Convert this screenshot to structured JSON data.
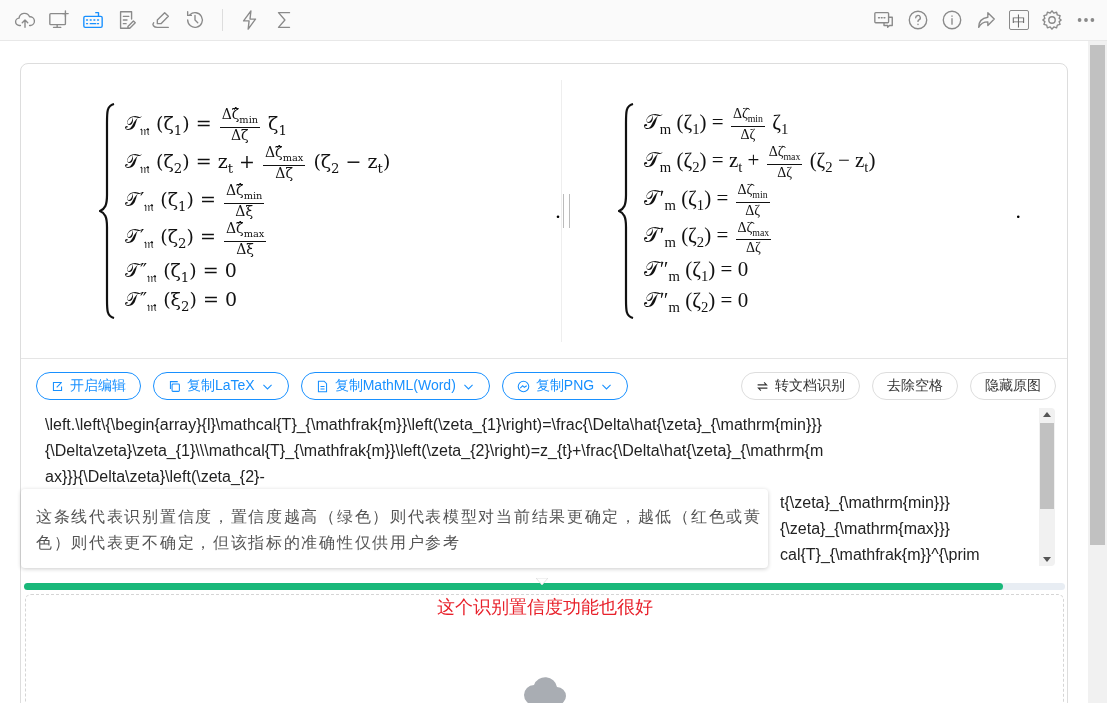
{
  "toolbar": {
    "left": [
      {
        "kind": "cloud-upload",
        "selected": false
      },
      {
        "kind": "monitor-plus",
        "selected": false
      },
      {
        "kind": "keyboard",
        "selected": true
      },
      {
        "kind": "document-edit",
        "selected": false
      },
      {
        "kind": "signature",
        "selected": false
      },
      {
        "kind": "history",
        "selected": false
      },
      {
        "kind": "divider"
      },
      {
        "kind": "lightning",
        "selected": false
      },
      {
        "kind": "sigma",
        "selected": false
      }
    ],
    "right": [
      {
        "kind": "chat",
        "selected": false
      },
      {
        "kind": "help",
        "selected": false
      },
      {
        "kind": "info",
        "selected": false
      },
      {
        "kind": "share",
        "selected": false
      },
      {
        "kind": "glyph",
        "text": "中",
        "selected": false
      },
      {
        "kind": "settings",
        "selected": false
      },
      {
        "kind": "more",
        "selected": false
      }
    ]
  },
  "formula_panels": [
    {
      "terminator": ".",
      "lines": [
        [
          {
            "kind": "text",
            "text": "𝒯$_{𝔪}$ (ζ$_{1}$) = "
          },
          {
            "kind": "frac",
            "num": "Δζ̂$_{min}$",
            "den": "Δζ"
          },
          {
            "kind": "text",
            "text": " ζ$_{1}$"
          }
        ],
        [
          {
            "kind": "text",
            "text": "𝒯$_{𝔪}$ (ζ$_{2}$) = z$_{t}$ + "
          },
          {
            "kind": "frac",
            "num": "Δζ̂$_{max}$",
            "den": "Δζ"
          },
          {
            "kind": "text",
            "text": " (ζ$_{2}$ − z$_{t}$)"
          }
        ],
        [
          {
            "kind": "text",
            "text": "𝒯′$_{𝔪}$ (ζ$_{1}$) = "
          },
          {
            "kind": "frac",
            "num": "Δζ̂$_{min}$",
            "den": "Δξ"
          }
        ],
        [
          {
            "kind": "text",
            "text": "𝒯′$_{𝔪}$ (ζ$_{2}$) = "
          },
          {
            "kind": "frac",
            "num": "Δζ̂$_{max}$",
            "den": "Δξ"
          }
        ],
        [
          {
            "kind": "text",
            "text": "𝒯″$_{𝔪}$ (ζ$_{1}$) = 0"
          }
        ],
        [
          {
            "kind": "text",
            "text": "𝒯″$_{𝔪}$ (ξ$_{2}$) = 0"
          }
        ]
      ]
    },
    {
      "terminator": ".",
      "lines": [
        [
          {
            "kind": "text",
            "text": "𝒯$_{m}$ (ζ$_{1}$) = "
          },
          {
            "kind": "frac",
            "num": "Δζ̂$_{min}$",
            "den": "Δζ"
          },
          {
            "kind": "text",
            "text": " ζ$_{1}$"
          }
        ],
        [
          {
            "kind": "text",
            "text": "𝒯$_{m}$ (ζ$_{2}$) = z$_{t}$ + "
          },
          {
            "kind": "frac",
            "num": "Δζ̂$_{max}$",
            "den": "Δζ"
          },
          {
            "kind": "text",
            "text": " (ζ$_{2}$ − z$_{t}$)"
          }
        ],
        [
          {
            "kind": "text",
            "text": "𝒯′$_{m}$ (ζ$_{1}$) = "
          },
          {
            "kind": "frac",
            "num": "Δζ̂$_{min}$",
            "den": "Δζ"
          }
        ],
        [
          {
            "kind": "text",
            "text": "𝒯′$_{m}$ (ζ$_{2}$) = "
          },
          {
            "kind": "frac",
            "num": "Δζ̂$_{max}$",
            "den": "Δζ"
          }
        ],
        [
          {
            "kind": "text",
            "text": "𝒯″$_{m}$ (ζ$_{1}$) = 0"
          }
        ],
        [
          {
            "kind": "text",
            "text": "𝒯″$_{m}$ (ζ$_{2}$) = 0"
          }
        ]
      ]
    }
  ],
  "actions": [
    {
      "kind": "primary",
      "label": "开启编辑",
      "dropdown": false
    },
    {
      "kind": "primary",
      "label": "复制LaTeX",
      "dropdown": true
    },
    {
      "kind": "primary",
      "label": "复制MathML(Word)",
      "dropdown": true
    },
    {
      "kind": "primary",
      "label": "复制PNG",
      "dropdown": true
    },
    {
      "kind": "default",
      "label": "转文档识别",
      "dropdown": false
    },
    {
      "kind": "default",
      "label": "去除空格",
      "dropdown": false
    },
    {
      "kind": "default",
      "label": "隐藏原图",
      "dropdown": false
    }
  ],
  "latex_editor": {
    "lines": [
      {
        "kind": "full",
        "text": "\\left.\\left\\{\\begin{array}{l}\\mathcal{T}_{\\mathfrak{m}}\\left(\\zeta_{1}\\right)=\\frac{\\Delta\\hat{\\zeta}_{\\mathrm{min}}}"
      },
      {
        "kind": "full",
        "text": "{\\Delta\\zeta}\\zeta_{1}\\\\\\mathcal{T}_{\\mathfrak{m}}\\left(\\zeta_{2}\\right)=z_{t}+\\frac{\\Delta\\hat{\\zeta}_{\\mathrm{m"
      },
      {
        "kind": "full",
        "text": "ax}}}{\\Delta\\zeta}\\left(\\zeta_{2}-"
      },
      {
        "kind": "tail",
        "text": "t{\\zeta}_{\\mathrm{min}}}"
      },
      {
        "kind": "tail",
        "text": "{\\zeta}_{\\mathrm{max}}}"
      },
      {
        "kind": "tail",
        "text": "cal{T}_{\\mathfrak{m}}^{\\prim"
      }
    ]
  },
  "tooltip": "这条线代表识别置信度，置信度越高（绿色）则代表模型对当前结果更确定，越低（红色或黄色）则代表更不确定，但该指标的准确性仅供用户参考",
  "confidence": {
    "level": 0.94
  },
  "annotation": "这个识别置信度功能也很好"
}
